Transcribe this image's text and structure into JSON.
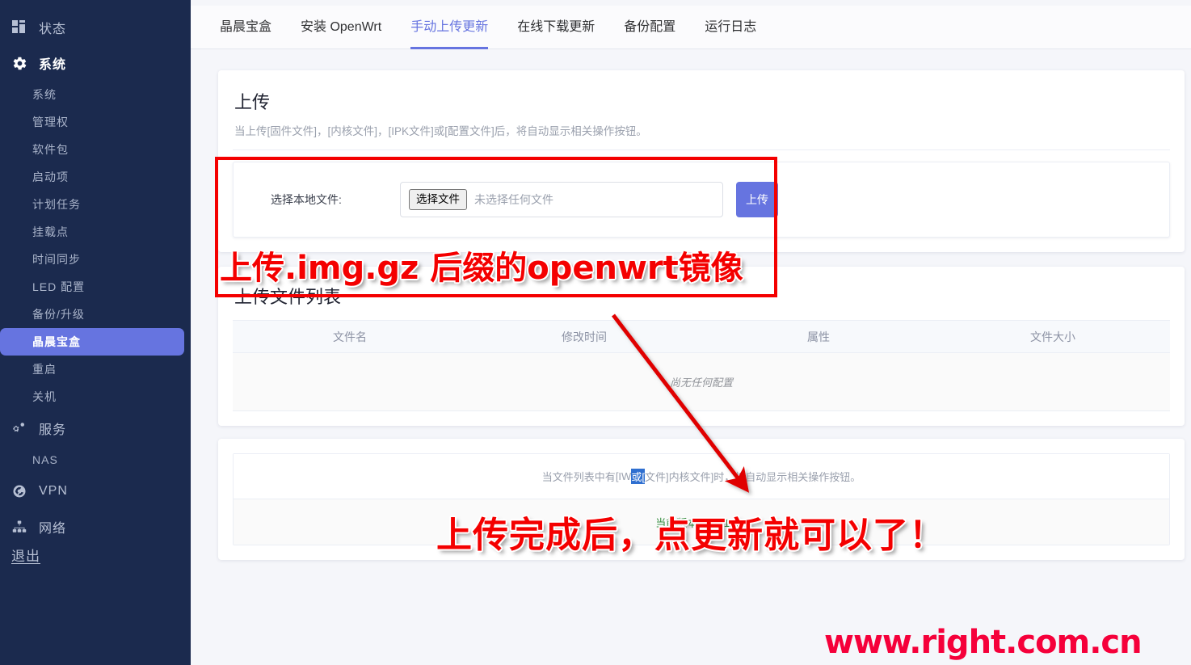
{
  "sidebar": {
    "groups": [
      {
        "icon": "dashboard-icon",
        "label": "状态",
        "active": false,
        "children": []
      },
      {
        "icon": "gear-icon",
        "label": "系统",
        "active": true,
        "children": [
          "系统",
          "管理权",
          "软件包",
          "启动项",
          "计划任务",
          "挂载点",
          "时间同步",
          "LED 配置",
          "备份/升级",
          "晶晨宝盒",
          "重启",
          "关机"
        ],
        "selected_child": "晶晨宝盒"
      },
      {
        "icon": "services-icon",
        "label": "服务",
        "active": false,
        "children": [
          "NAS"
        ]
      },
      {
        "icon": "vpn-icon",
        "label": "VPN",
        "active": false,
        "children": []
      },
      {
        "icon": "network-icon",
        "label": "网络",
        "active": false,
        "children": []
      }
    ],
    "logout_label": "退出"
  },
  "tabs": [
    {
      "label": "晶晨宝盒",
      "active": false
    },
    {
      "label": "安装 OpenWrt",
      "active": false
    },
    {
      "label": "手动上传更新",
      "active": true
    },
    {
      "label": "在线下载更新",
      "active": false
    },
    {
      "label": "备份配置",
      "active": false
    },
    {
      "label": "运行日志",
      "active": false
    }
  ],
  "upload": {
    "title": "上传",
    "description": "当上传[固件文件]，[内核文件]，[IPK文件]或[配置文件]后，将自动显示相关操作按钮。",
    "field_label": "选择本地文件:",
    "choose_button": "选择文件",
    "no_file_text": "未选择任何文件",
    "upload_button": "上传"
  },
  "file_list": {
    "title": "上传文件列表",
    "columns": [
      "文件名",
      "修改时间",
      "属性",
      "文件大小"
    ],
    "empty_text": "尚无任何配置"
  },
  "bottom_info": {
    "note_part_1": "当文件列表中有",
    "note_mark_a": "[IW",
    "note_part_2": "或[",
    "note_mark_b": "文件]",
    "note_part_3": "内核文件]",
    "note_part_4": "时，将自动显示相关操作按钮。",
    "version_text": "当前版本 [ 5.4.126 ]"
  },
  "annotations": {
    "box_note": "上传.img.gz 后缀的openwrt镜像",
    "arrow_note": "上传完成后，点更新就可以了！",
    "watermark": "www.right.com.cn",
    "accent_color": "#6674e0",
    "annotation_color": "#f40000"
  }
}
